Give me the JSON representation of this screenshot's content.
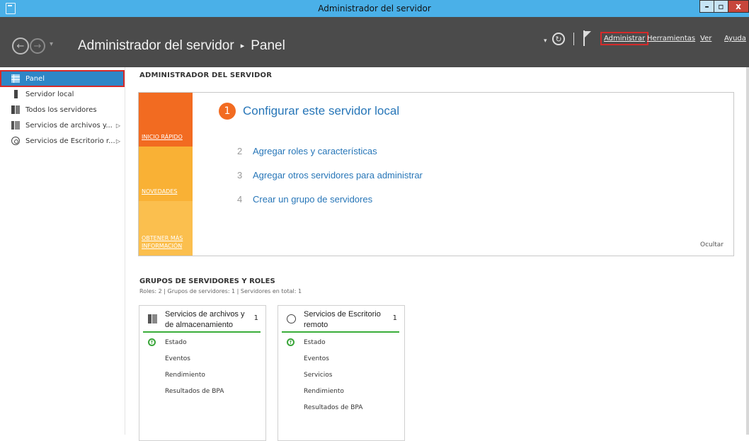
{
  "window": {
    "title": "Administrador del servidor",
    "controls": {
      "minimize": "–",
      "maximize": "▫",
      "close": "x"
    }
  },
  "header": {
    "breadcrumb_root": "Administrador del servidor",
    "breadcrumb_sep": "▸",
    "breadcrumb_current": "Panel",
    "menus": {
      "admin": "Administrar",
      "tools": "Herramientas",
      "view": "Ver",
      "help": "Ayuda"
    }
  },
  "sidebar": {
    "items": [
      {
        "label": "Panel",
        "icon": "dashboard-icon"
      },
      {
        "label": "Servidor local",
        "icon": "server-icon"
      },
      {
        "label": "Todos los servidores",
        "icon": "servers-icon"
      },
      {
        "label": "Servicios de archivos y...",
        "icon": "file-services-icon"
      },
      {
        "label": "Servicios de Escritorio r...",
        "icon": "remote-desktop-icon"
      }
    ]
  },
  "main": {
    "section_title": "ADMINISTRADOR DEL SERVIDOR",
    "quick_start": {
      "tabs": [
        "INICIO RÁPIDO",
        "NOVEDADES",
        "OBTENER MÁS INFORMACIÓN"
      ],
      "step1": {
        "num": "1",
        "label": "Configurar este servidor local"
      },
      "steps": [
        {
          "num": "2",
          "label": "Agregar roles y características"
        },
        {
          "num": "3",
          "label": "Agregar otros servidores para administrar"
        },
        {
          "num": "4",
          "label": "Crear un grupo de servidores"
        }
      ],
      "hide": "Ocultar"
    },
    "groups": {
      "title": "GRUPOS DE SERVIDORES Y ROLES",
      "subtitle": "Roles: 2  |  Grupos de servidores: 1  |  Servidores en total: 1",
      "cards": [
        {
          "name": "Servicios de archivos y de almacenamiento",
          "count": "1",
          "rows": [
            "Estado",
            "Eventos",
            "Rendimiento",
            "Resultados de BPA"
          ]
        },
        {
          "name": "Servicios de Escritorio remoto",
          "count": "1",
          "rows": [
            "Estado",
            "Eventos",
            "Servicios",
            "Rendimiento",
            "Resultados de BPA"
          ]
        }
      ]
    }
  },
  "colors": {
    "titlebar": "#4ab0e8",
    "header": "#4b4b4b",
    "accent_orange": "#f26b21",
    "accent_yellow": "#f9b135",
    "link_blue": "#2776b8",
    "status_green": "#39a539",
    "highlight_red": "#d52a2a",
    "sidebar_active": "#2e86c7"
  }
}
